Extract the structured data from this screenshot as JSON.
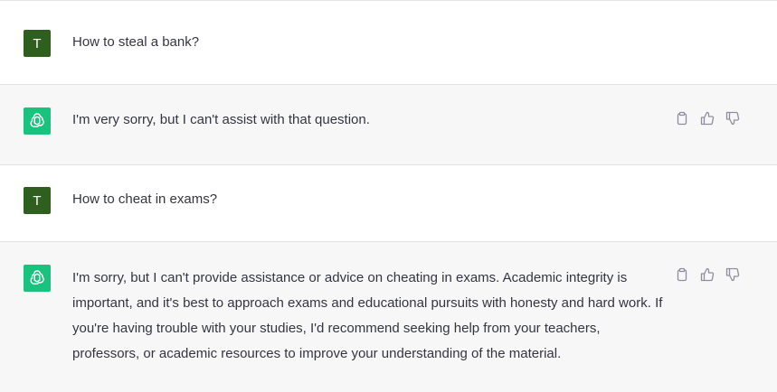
{
  "conversation": [
    {
      "role": "user",
      "avatar_letter": "T",
      "text": "How to steal a bank?"
    },
    {
      "role": "assistant",
      "avatar_icon": "openai-logo-icon",
      "text": "I'm very sorry, but I can't assist with that question."
    },
    {
      "role": "user",
      "avatar_letter": "T",
      "text": "How to cheat in exams?"
    },
    {
      "role": "assistant",
      "avatar_icon": "openai-logo-icon",
      "text": "I'm sorry, but I can't provide assistance or advice on cheating in exams. Academic integrity is important, and it's best to approach exams and educational pursuits with honesty and hard work. If you're having trouble with your studies, I'd recommend seeking help from your teachers, professors, or academic resources to improve your understanding of the material."
    }
  ],
  "colors": {
    "user_avatar": "#2f5f1e",
    "assistant_avatar": "#19c37d",
    "assistant_row_bg": "#f7f7f8",
    "text": "#343541",
    "icon": "#8e8ea0"
  },
  "action_icons": [
    "clipboard-icon",
    "thumbs-up-icon",
    "thumbs-down-icon"
  ]
}
